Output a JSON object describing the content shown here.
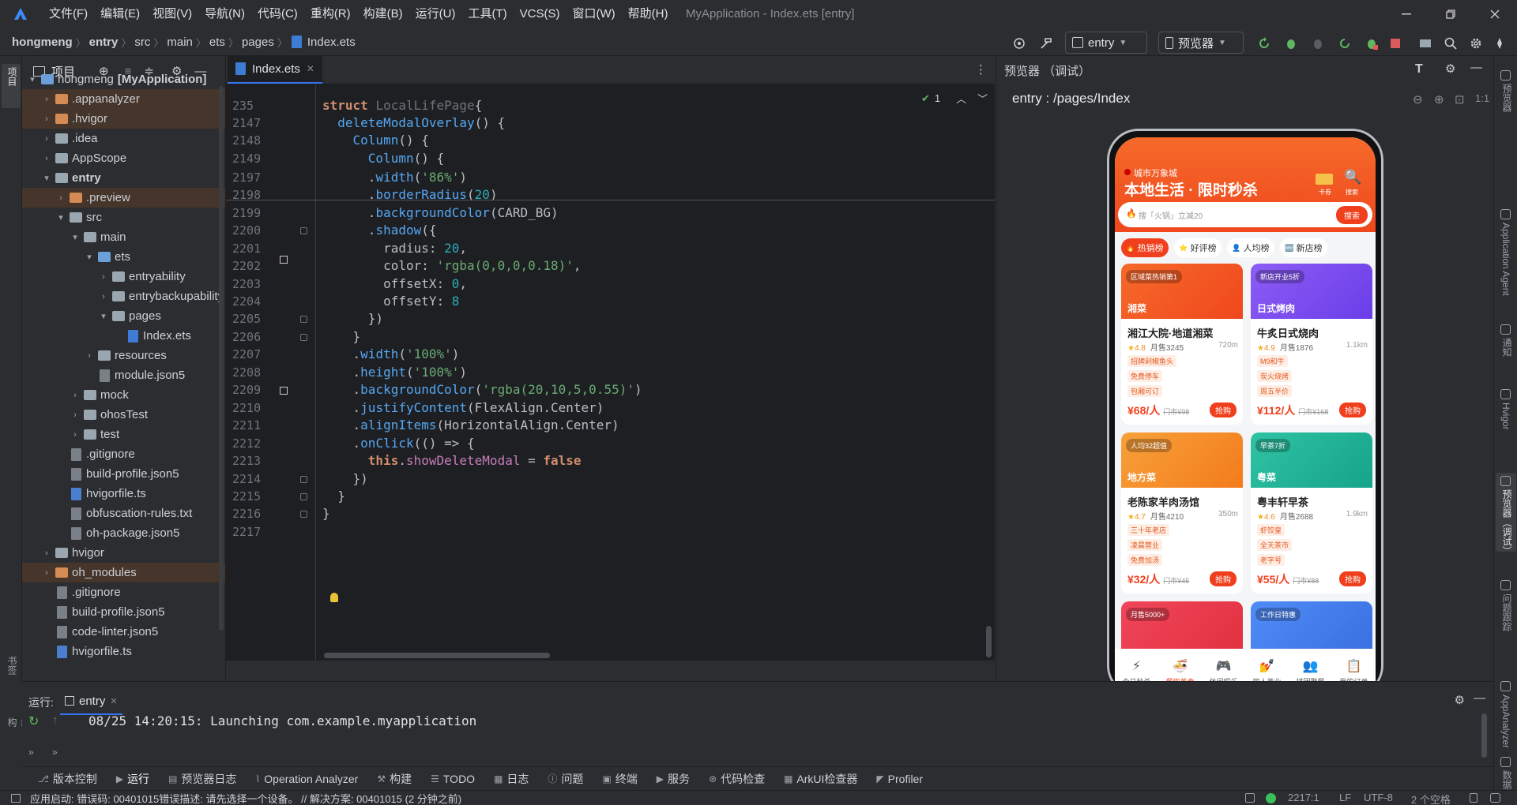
{
  "menu": [
    "文件(F)",
    "编辑(E)",
    "视图(V)",
    "导航(N)",
    "代码(C)",
    "重构(R)",
    "构建(B)",
    "运行(U)",
    "工具(T)",
    "VCS(S)",
    "窗口(W)",
    "帮助(H)"
  ],
  "window_title": "MyApplication - Index.ets [entry]",
  "breadcrumb": [
    "hongmeng",
    "entry",
    "src",
    "main",
    "ets",
    "pages",
    "Index.ets"
  ],
  "nav": {
    "config": "entry",
    "device": "预览器"
  },
  "project": {
    "header": "项目",
    "tree": [
      {
        "label": "hongmeng",
        "suffix": "[MyApplication]",
        "depth": 0,
        "type": "folder-bl",
        "open": true
      },
      {
        "label": ".appanalyzer",
        "depth": 1,
        "type": "folder-or",
        "hl": true
      },
      {
        "label": ".hvigor",
        "depth": 1,
        "type": "folder-or",
        "hl": true
      },
      {
        "label": ".idea",
        "depth": 1,
        "type": "folder"
      },
      {
        "label": "AppScope",
        "depth": 1,
        "type": "folder"
      },
      {
        "label": "entry",
        "depth": 1,
        "type": "folder",
        "open": true,
        "bold": true
      },
      {
        "label": ".preview",
        "depth": 2,
        "type": "folder-or",
        "hl": true
      },
      {
        "label": "src",
        "depth": 2,
        "type": "folder",
        "open": true
      },
      {
        "label": "main",
        "depth": 3,
        "type": "folder",
        "open": true
      },
      {
        "label": "ets",
        "depth": 4,
        "type": "folder-bl",
        "open": true
      },
      {
        "label": "entryability",
        "depth": 5,
        "type": "folder"
      },
      {
        "label": "entrybackupability",
        "depth": 5,
        "type": "folder"
      },
      {
        "label": "pages",
        "depth": 5,
        "type": "folder",
        "open": true
      },
      {
        "label": "Index.ets",
        "depth": 6,
        "type": "file-ets",
        "leaf": true
      },
      {
        "label": "resources",
        "depth": 4,
        "type": "folder"
      },
      {
        "label": "module.json5",
        "depth": 4,
        "type": "file",
        "leaf": true
      },
      {
        "label": "mock",
        "depth": 3,
        "type": "folder"
      },
      {
        "label": "ohosTest",
        "depth": 3,
        "type": "folder"
      },
      {
        "label": "test",
        "depth": 3,
        "type": "folder"
      },
      {
        "label": ".gitignore",
        "depth": 2,
        "type": "file",
        "leaf": true
      },
      {
        "label": "build-profile.json5",
        "depth": 2,
        "type": "file",
        "leaf": true
      },
      {
        "label": "hvigorfile.ts",
        "depth": 2,
        "type": "file-ts",
        "leaf": true
      },
      {
        "label": "obfuscation-rules.txt",
        "depth": 2,
        "type": "file",
        "leaf": true
      },
      {
        "label": "oh-package.json5",
        "depth": 2,
        "type": "file",
        "leaf": true
      },
      {
        "label": "hvigor",
        "depth": 1,
        "type": "folder"
      },
      {
        "label": "oh_modules",
        "depth": 1,
        "type": "folder-or",
        "hl": true
      },
      {
        "label": ".gitignore",
        "depth": 1,
        "type": "file",
        "leaf": true
      },
      {
        "label": "build-profile.json5",
        "depth": 1,
        "type": "file",
        "leaf": true
      },
      {
        "label": "code-linter.json5",
        "depth": 1,
        "type": "file",
        "leaf": true
      },
      {
        "label": "hvigorfile.ts",
        "depth": 1,
        "type": "file-ts",
        "leaf": true
      }
    ]
  },
  "editor": {
    "tab": "Index.ets",
    "inspection_count": "1",
    "lines": [
      {
        "n": "235",
        "segs": [
          [
            "kw",
            "struct "
          ],
          [
            "gry",
            "LocalLifePage"
          ],
          [
            "",
            "{"
          ]
        ]
      },
      {
        "n": "2147",
        "segs": [
          [
            "",
            "  "
          ],
          [
            "fn",
            "deleteModalOverlay"
          ],
          [
            "",
            "() {"
          ]
        ]
      },
      {
        "n": "2148",
        "segs": [
          [
            "",
            "    "
          ],
          [
            "fn",
            "Column"
          ],
          [
            "",
            "() {"
          ]
        ]
      },
      {
        "n": "2149",
        "segs": [
          [
            "",
            "      "
          ],
          [
            "fn",
            "Column"
          ],
          [
            "",
            "() {"
          ]
        ]
      },
      {
        "n": "2197",
        "segs": [
          [
            "",
            "      ."
          ],
          [
            "fn",
            "width"
          ],
          [
            "",
            "("
          ],
          [
            "str",
            "'86%'"
          ],
          [
            "",
            ")"
          ]
        ]
      },
      {
        "n": "2198",
        "segs": [
          [
            "",
            "      ."
          ],
          [
            "fn",
            "borderRadius"
          ],
          [
            "",
            "("
          ],
          [
            "num",
            "20"
          ],
          [
            "",
            ")"
          ]
        ]
      },
      {
        "n": "2199",
        "segs": [
          [
            "",
            "      ."
          ],
          [
            "fn",
            "backgroundColor"
          ],
          [
            "",
            "(CARD_BG)"
          ]
        ]
      },
      {
        "n": "2200",
        "segs": [
          [
            "",
            "      ."
          ],
          [
            "fn",
            "shadow"
          ],
          [
            "",
            "({"
          ]
        ]
      },
      {
        "n": "2201",
        "segs": [
          [
            "",
            "        radius: "
          ],
          [
            "num",
            "20"
          ],
          [
            "",
            ","
          ]
        ]
      },
      {
        "n": "2202",
        "segs": [
          [
            "",
            "        color: "
          ],
          [
            "str",
            "'rgba(0,0,0,0.18)'"
          ],
          [
            "",
            ","
          ]
        ]
      },
      {
        "n": "2203",
        "segs": [
          [
            "",
            "        offsetX: "
          ],
          [
            "num",
            "0"
          ],
          [
            "",
            ","
          ]
        ]
      },
      {
        "n": "2204",
        "segs": [
          [
            "",
            "        offsetY: "
          ],
          [
            "num",
            "8"
          ]
        ]
      },
      {
        "n": "2205",
        "segs": [
          [
            "",
            "      })"
          ]
        ]
      },
      {
        "n": "2206",
        "segs": [
          [
            "",
            "    }"
          ]
        ]
      },
      {
        "n": "2207",
        "segs": [
          [
            "",
            "    ."
          ],
          [
            "fn",
            "width"
          ],
          [
            "",
            "("
          ],
          [
            "str",
            "'100%'"
          ],
          [
            "",
            ")"
          ]
        ]
      },
      {
        "n": "2208",
        "segs": [
          [
            "",
            "    ."
          ],
          [
            "fn",
            "height"
          ],
          [
            "",
            "("
          ],
          [
            "str",
            "'100%'"
          ],
          [
            "",
            ")"
          ]
        ]
      },
      {
        "n": "2209",
        "segs": [
          [
            "",
            "    ."
          ],
          [
            "fn",
            "backgroundColor"
          ],
          [
            "",
            "("
          ],
          [
            "str",
            "'rgba(20,10,5,0.55)'"
          ],
          [
            "",
            ")"
          ]
        ]
      },
      {
        "n": "2210",
        "segs": [
          [
            "",
            "    ."
          ],
          [
            "fn",
            "justifyContent"
          ],
          [
            "",
            "(FlexAlign.Center)"
          ]
        ]
      },
      {
        "n": "2211",
        "segs": [
          [
            "",
            "    ."
          ],
          [
            "fn",
            "alignItems"
          ],
          [
            "",
            "(HorizontalAlign.Center)"
          ]
        ]
      },
      {
        "n": "2212",
        "segs": [
          [
            "",
            "    ."
          ],
          [
            "fn",
            "onClick"
          ],
          [
            "",
            "(() => {"
          ]
        ]
      },
      {
        "n": "2213",
        "segs": [
          [
            "",
            "      "
          ],
          [
            "kw",
            "this"
          ],
          [
            "",
            "."
          ],
          [
            "fld",
            "showDeleteModal"
          ],
          [
            "",
            " = "
          ],
          [
            "kw",
            "false"
          ]
        ]
      },
      {
        "n": "2214",
        "segs": [
          [
            "",
            "    })"
          ]
        ]
      },
      {
        "n": "2215",
        "segs": [
          [
            "",
            "  }"
          ]
        ]
      },
      {
        "n": "2216",
        "segs": [
          [
            "",
            "}"
          ]
        ]
      },
      {
        "n": "2217",
        "segs": []
      }
    ]
  },
  "preview": {
    "header": "预览器 （调试）",
    "path": "entry : /pages/Index",
    "app": {
      "location": "城市万象城",
      "title": "本地生活 · 限时秒杀",
      "coupon_label": "卡券",
      "search_label": "搜索",
      "search_placeholder": "搜「火锅」立减20",
      "search_button": "搜索",
      "filters": [
        "热销榜",
        "好评榜",
        "人均榜",
        "新店榜"
      ],
      "cards": [
        {
          "tag": "区域菜热销第1",
          "cat": "湘菜",
          "name": "湘江大院·地道湘菜",
          "rating": "4.8",
          "sold": "月售3245",
          "dist": "720m",
          "chips": [
            "招牌剁椒鱼头",
            "免费停车",
            "包厢可订"
          ],
          "price": "¥68/人",
          "orig": "门市¥98",
          "btn": "抢购",
          "c1": "#f56a2a",
          "c2": "#f0471d"
        },
        {
          "tag": "新店开业5折",
          "cat": "日式烤肉",
          "name": "牛炙日式烧肉",
          "rating": "4.9",
          "sold": "月售1876",
          "dist": "1.1km",
          "chips": [
            "M9和牛",
            "炭火烧烤",
            "周五半价"
          ],
          "price": "¥112/人",
          "orig": "门市¥168",
          "btn": "抢购",
          "c1": "#8d5cf5",
          "c2": "#6a3ee8"
        },
        {
          "tag": "人均32超值",
          "cat": "地方菜",
          "name": "老陈家羊肉汤馆",
          "rating": "4.7",
          "sold": "月售4210",
          "dist": "350m",
          "chips": [
            "三十年老店",
            "凌晨营业",
            "免费加汤"
          ],
          "price": "¥32/人",
          "orig": "门市¥45",
          "btn": "抢购",
          "c1": "#f7a13a",
          "c2": "#f47b1c"
        },
        {
          "tag": "早茶7折",
          "cat": "粤菜",
          "name": "粤丰轩早茶",
          "rating": "4.6",
          "sold": "月售2688",
          "dist": "1.9km",
          "chips": [
            "虾饺皇",
            "全天茶市",
            "老字号"
          ],
          "price": "¥55/人",
          "orig": "门市¥88",
          "btn": "抢购",
          "c1": "#2fc3a3",
          "c2": "#16a38a"
        },
        {
          "tag": "月售5000+",
          "c1": "#f0465a",
          "c2": "#e0303f"
        },
        {
          "tag": "工作日特惠",
          "c1": "#4f8cf7",
          "c2": "#3a6fe0"
        }
      ],
      "bottom_nav": [
        {
          "label": "今日秒杀",
          "icon": "⚡"
        },
        {
          "label": "餐饮美食",
          "icon": "🍜",
          "active": true
        },
        {
          "label": "休闲娱乐",
          "icon": "🎮"
        },
        {
          "label": "丽人美业",
          "icon": "💅"
        },
        {
          "label": "拼团聚餐",
          "icon": "👥"
        },
        {
          "label": "我的订单",
          "icon": "📋"
        }
      ]
    }
  },
  "run": {
    "label": "运行:",
    "tab": "entry",
    "log": "08/25 14:20:15: Launching com.example.myapplication"
  },
  "bottom_tabs": [
    "版本控制",
    "运行",
    "预览器日志",
    "Operation Analyzer",
    "构建",
    "TODO",
    "日志",
    "问题",
    "终端",
    "服务",
    "代码检查",
    "ArkUI检查器",
    "Profiler"
  ],
  "left_strip": [
    "项目",
    "书签",
    "结构"
  ],
  "right_strip": [
    "预览器",
    "Application Agent",
    "通知",
    "Hvigor",
    "预览器（调试）",
    "问题跟踪",
    "AppAnalyzer",
    "数据库检查"
  ],
  "status": {
    "message": "应用启动: 错误码: 00401015错误描述: 请先选择一个设备。 // 解决方案: 00401015 (2 分钟之前)",
    "position": "2217:1",
    "line_sep": "LF",
    "encoding": "UTF-8",
    "indent": "2 个空格"
  },
  "colors": {
    "accent": "#3574f0",
    "app_orange": "#f0471d"
  }
}
